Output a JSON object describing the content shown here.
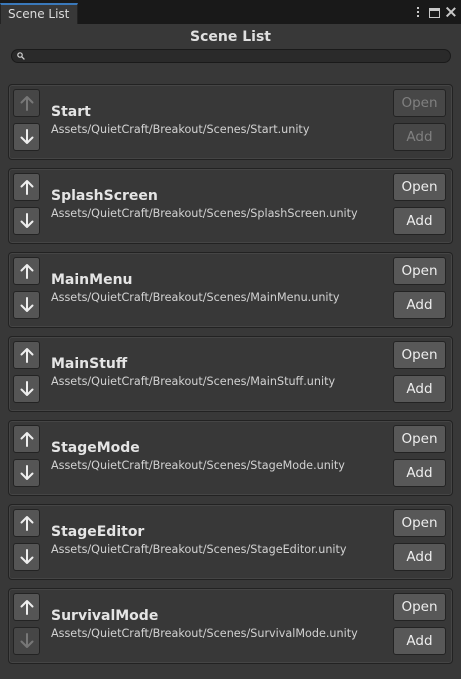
{
  "window": {
    "tab_label": "Scene List",
    "title": "Scene List"
  },
  "search": {
    "placeholder": ""
  },
  "buttons": {
    "open_label": "Open",
    "add_label": "Add"
  },
  "scenes": [
    {
      "name": "Start",
      "path": "Assets/QuietCraft/Breakout/Scenes/Start.unity",
      "up_enabled": false,
      "down_enabled": true,
      "open_enabled": false,
      "add_enabled": false
    },
    {
      "name": "SplashScreen",
      "path": "Assets/QuietCraft/Breakout/Scenes/SplashScreen.unity",
      "up_enabled": true,
      "down_enabled": true,
      "open_enabled": true,
      "add_enabled": true
    },
    {
      "name": "MainMenu",
      "path": "Assets/QuietCraft/Breakout/Scenes/MainMenu.unity",
      "up_enabled": true,
      "down_enabled": true,
      "open_enabled": true,
      "add_enabled": true
    },
    {
      "name": "MainStuff",
      "path": "Assets/QuietCraft/Breakout/Scenes/MainStuff.unity",
      "up_enabled": true,
      "down_enabled": true,
      "open_enabled": true,
      "add_enabled": true
    },
    {
      "name": "StageMode",
      "path": "Assets/QuietCraft/Breakout/Scenes/StageMode.unity",
      "up_enabled": true,
      "down_enabled": true,
      "open_enabled": true,
      "add_enabled": true
    },
    {
      "name": "StageEditor",
      "path": "Assets/QuietCraft/Breakout/Scenes/StageEditor.unity",
      "up_enabled": true,
      "down_enabled": true,
      "open_enabled": true,
      "add_enabled": true
    },
    {
      "name": "SurvivalMode",
      "path": "Assets/QuietCraft/Breakout/Scenes/SurvivalMode.unity",
      "up_enabled": true,
      "down_enabled": false,
      "open_enabled": true,
      "add_enabled": true
    }
  ],
  "icons": {
    "up": "arrow-up-icon",
    "down": "arrow-down-icon",
    "search": "search-icon",
    "menu": "kebab-menu-icon",
    "maximize": "maximize-icon",
    "close": "close-icon"
  },
  "colors": {
    "background": "#383838",
    "tab_accent": "#3a79bb",
    "button": "#585858",
    "button_disabled": "#474747"
  }
}
